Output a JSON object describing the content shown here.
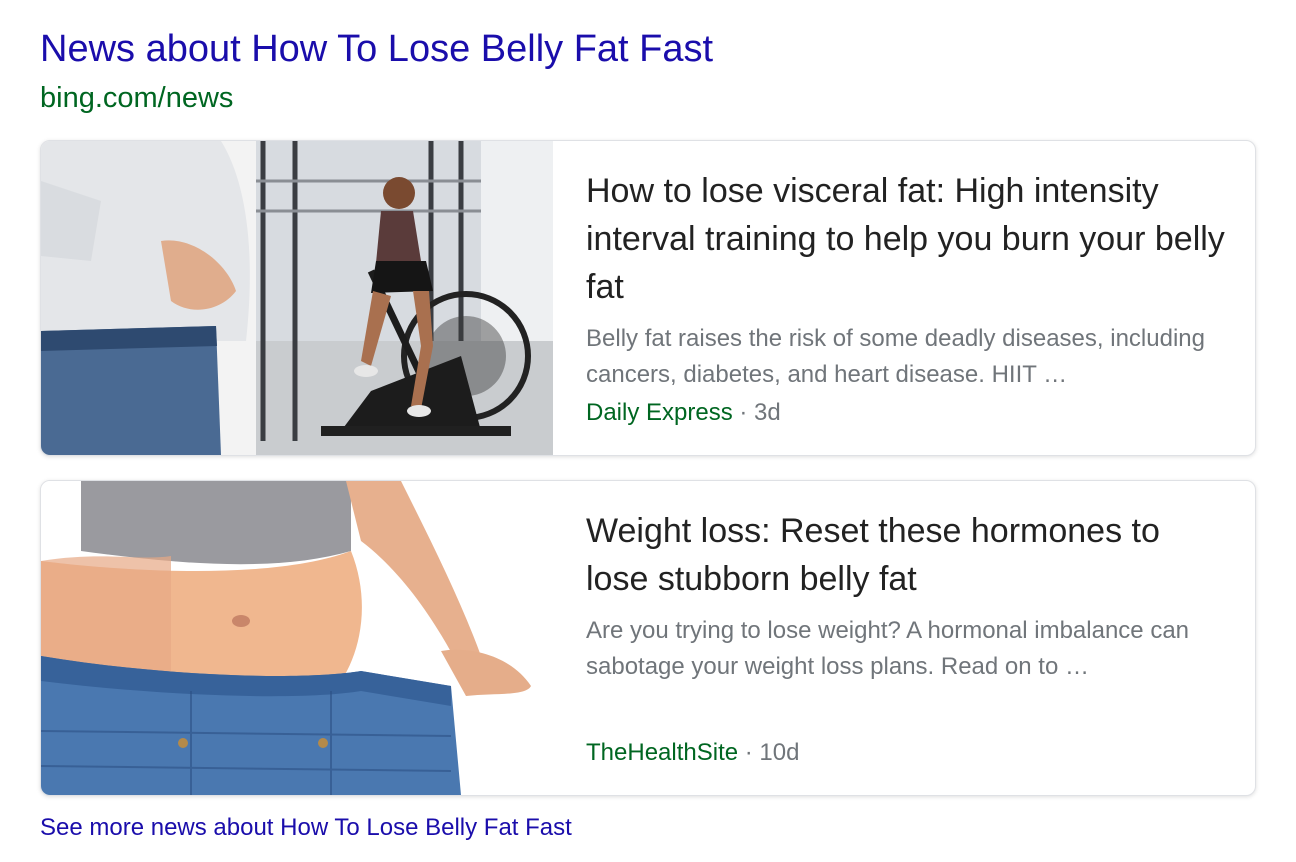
{
  "header": {
    "title": "News about How To Lose Belly Fat Fast",
    "url": "bing.com/news"
  },
  "cards": [
    {
      "title": "How to lose visceral fat: High intensity interval training to help you burn your belly fat",
      "snippet": "Belly fat raises the risk of some deadly diseases, including cancers, diabetes, and heart disease. HIIT …",
      "source": "Daily Express",
      "separator": " · ",
      "age": "3d"
    },
    {
      "title": "Weight loss: Reset these hormones to lose stubborn belly fat",
      "snippet": "Are you trying to lose weight? A hormonal imbalance can sabotage your weight loss plans. Read on to …",
      "source": "TheHealthSite",
      "separator": " · ",
      "age": "10d"
    }
  ],
  "footer": {
    "see_more": "See more news about How To Lose Belly Fat Fast"
  },
  "colors": {
    "link": "#1a0dab",
    "url_green": "#006621",
    "title_text": "#222222",
    "snippet_gray": "#70757a",
    "card_border": "#dfe1e5"
  }
}
